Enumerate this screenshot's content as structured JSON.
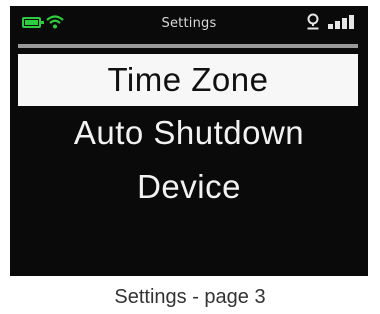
{
  "status_bar": {
    "title": "Settings",
    "battery_icon": "battery-icon",
    "wifi_icon": "wifi-icon",
    "location_icon": "location-pin-icon",
    "signal_icon": "signal-bars-icon",
    "accent_color": "#2ecc40"
  },
  "menu": {
    "items": [
      {
        "label": "Time Zone",
        "selected": true
      },
      {
        "label": "Auto Shutdown",
        "selected": false
      },
      {
        "label": "Device",
        "selected": false
      }
    ]
  },
  "caption": "Settings - page 3"
}
